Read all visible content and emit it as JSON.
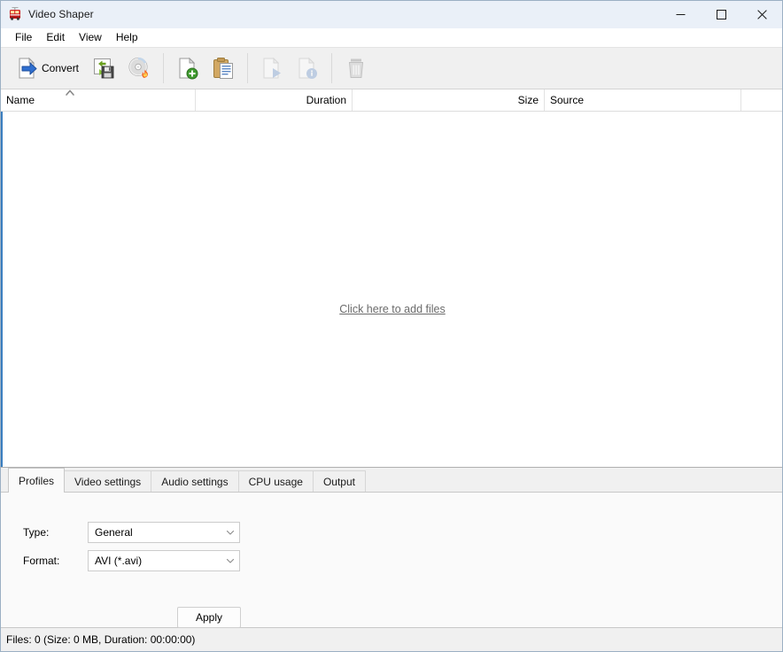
{
  "window": {
    "title": "Video Shaper",
    "icon": "tram-icon",
    "controls": {
      "minimize": "minimize-icon",
      "maximize": "maximize-icon",
      "close": "close-icon"
    }
  },
  "menubar": {
    "items": [
      {
        "label": "File"
      },
      {
        "label": "Edit"
      },
      {
        "label": "View"
      },
      {
        "label": "Help"
      }
    ]
  },
  "toolbar": {
    "buttons": [
      {
        "name": "convert-button",
        "label": "Convert",
        "icon": "convert-page-arrow-icon",
        "enabled": true
      },
      {
        "name": "save-profile-button",
        "label": "",
        "icon": "save-floppy-icon",
        "enabled": true
      },
      {
        "name": "burn-disc-button",
        "label": "",
        "icon": "cd-burn-icon",
        "enabled": true
      },
      {
        "name": "add-files-button",
        "label": "",
        "icon": "page-add-icon",
        "enabled": true
      },
      {
        "name": "paste-button",
        "label": "",
        "icon": "clipboard-paste-icon",
        "enabled": true
      },
      {
        "name": "play-button",
        "label": "",
        "icon": "page-play-icon",
        "enabled": false
      },
      {
        "name": "file-info-button",
        "label": "",
        "icon": "page-info-icon",
        "enabled": false
      },
      {
        "name": "delete-button",
        "label": "",
        "icon": "trash-icon",
        "enabled": false
      }
    ]
  },
  "filelist": {
    "columns": [
      {
        "key": "name",
        "label": "Name",
        "align": "left",
        "sorted": "asc"
      },
      {
        "key": "duration",
        "label": "Duration",
        "align": "right",
        "sorted": ""
      },
      {
        "key": "size",
        "label": "Size",
        "align": "right",
        "sorted": ""
      },
      {
        "key": "source",
        "label": "Source",
        "align": "left",
        "sorted": ""
      },
      {
        "key": "extra",
        "label": "",
        "align": "left",
        "sorted": ""
      }
    ],
    "rows": [],
    "empty_hint": "Click here to add files"
  },
  "bottom_panel": {
    "tabs": [
      {
        "label": "Profiles",
        "active": true
      },
      {
        "label": "Video settings",
        "active": false
      },
      {
        "label": "Audio settings",
        "active": false
      },
      {
        "label": "CPU usage",
        "active": false
      },
      {
        "label": "Output",
        "active": false
      }
    ],
    "profiles": {
      "type_label": "Type:",
      "type_value": "General",
      "format_label": "Format:",
      "format_value": "AVI (*.avi)",
      "apply_label": "Apply"
    }
  },
  "statusbar": {
    "text": "Files: 0 (Size: 0 MB, Duration: 00:00:00)"
  }
}
